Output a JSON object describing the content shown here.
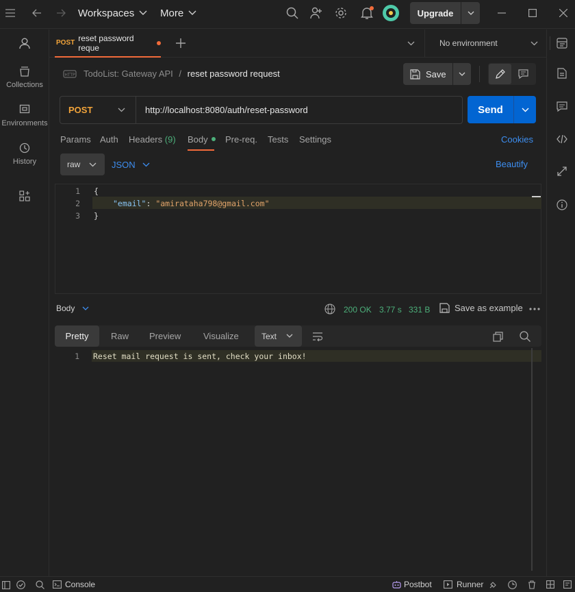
{
  "topbar": {
    "workspaces_label": "Workspaces",
    "more_label": "More",
    "upgrade_label": "Upgrade"
  },
  "sidebar": {
    "items": [
      {
        "label": ""
      },
      {
        "label": "Collections"
      },
      {
        "label": "Environments"
      },
      {
        "label": "History"
      },
      {
        "label": ""
      }
    ]
  },
  "tabs": {
    "active": {
      "method": "POST",
      "title": "reset password reque"
    },
    "environment": "No environment"
  },
  "request": {
    "collection": "TodoList: Gateway API",
    "separator": "/",
    "name": "reset password request",
    "save_label": "Save",
    "method": "POST",
    "url": "http://localhost:8080/auth/reset-password",
    "send_label": "Send"
  },
  "request_tabs": {
    "params": "Params",
    "auth": "Auth",
    "headers": "Headers",
    "headers_count": "(9)",
    "body": "Body",
    "prereq": "Pre-req.",
    "tests": "Tests",
    "settings": "Settings",
    "cookies": "Cookies"
  },
  "body_options": {
    "mode": "raw",
    "language": "JSON",
    "beautify": "Beautify"
  },
  "editor": {
    "lines": [
      {
        "n": "1",
        "text": "{"
      },
      {
        "n": "2",
        "key": "\"email\"",
        "colon": ": ",
        "value": "\"amirataha798@gmail.com\""
      },
      {
        "n": "3",
        "text": "}"
      }
    ]
  },
  "response": {
    "section_label": "Body",
    "status": "200 OK",
    "time": "3.77 s",
    "size": "331 B",
    "save_example": "Save as example",
    "tabs": {
      "pretty": "Pretty",
      "raw": "Raw",
      "preview": "Preview",
      "visualize": "Visualize"
    },
    "format": "Text",
    "lines": [
      {
        "n": "1",
        "text": "Reset mail request is sent, check your inbox!"
      }
    ]
  },
  "statusbar": {
    "console": "Console",
    "postbot": "Postbot",
    "runner": "Runner"
  },
  "colors": {
    "accent": "#f26b3a",
    "method_post": "#f2a43a",
    "send_button": "#0265d2",
    "link": "#3d8ef0",
    "status_ok": "#4caf7a",
    "json_string": "#e2a46a",
    "json_key": "#89c4f4"
  }
}
